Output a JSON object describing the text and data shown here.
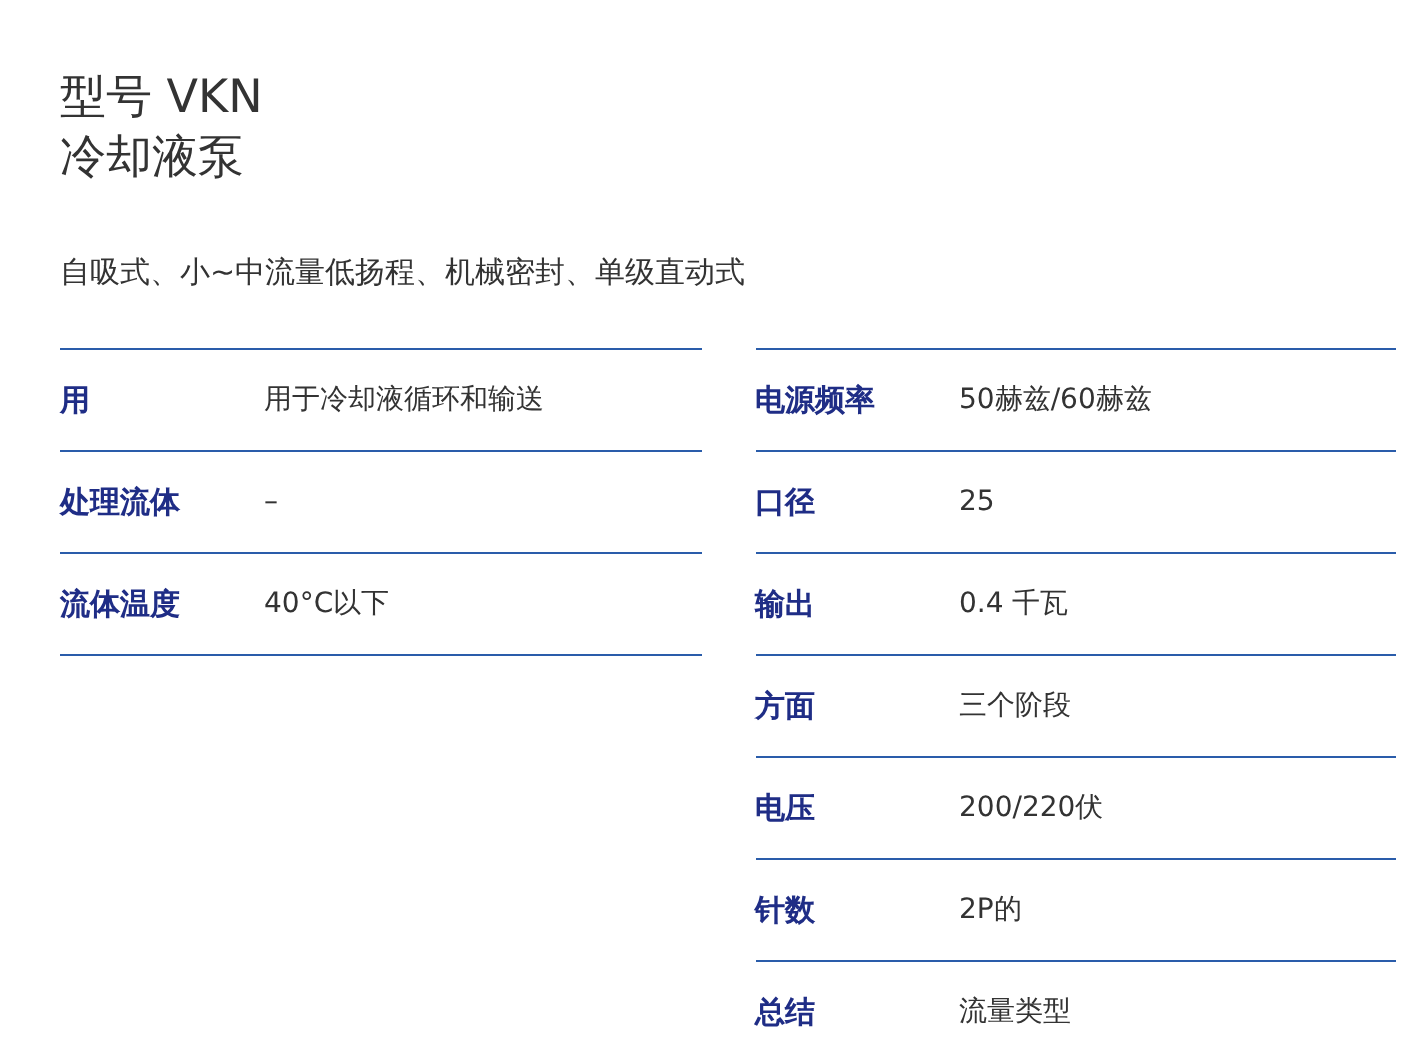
{
  "heading": {
    "model": "型号 VKN",
    "name": "冷却液泵"
  },
  "description": "自吸式、小~中流量低扬程、机械密封、单级直动式",
  "tables": [
    {
      "rows": [
        {
          "label": "用",
          "value": "用于冷却液循环和输送"
        },
        {
          "label": "处理流体",
          "value": "–"
        },
        {
          "label": "流体温度",
          "value": "40°C以下"
        }
      ]
    },
    {
      "rows": [
        {
          "label": "电源频率",
          "value": "50赫兹/60赫兹"
        },
        {
          "label": "口径",
          "value": "25"
        },
        {
          "label": "输出",
          "value": "0.4 千瓦"
        },
        {
          "label": "方面",
          "value": "三个阶段"
        },
        {
          "label": "电压",
          "value": "200/220伏"
        },
        {
          "label": "针数",
          "value": "2P的"
        },
        {
          "label": "总结",
          "value": "流量类型"
        }
      ]
    }
  ]
}
